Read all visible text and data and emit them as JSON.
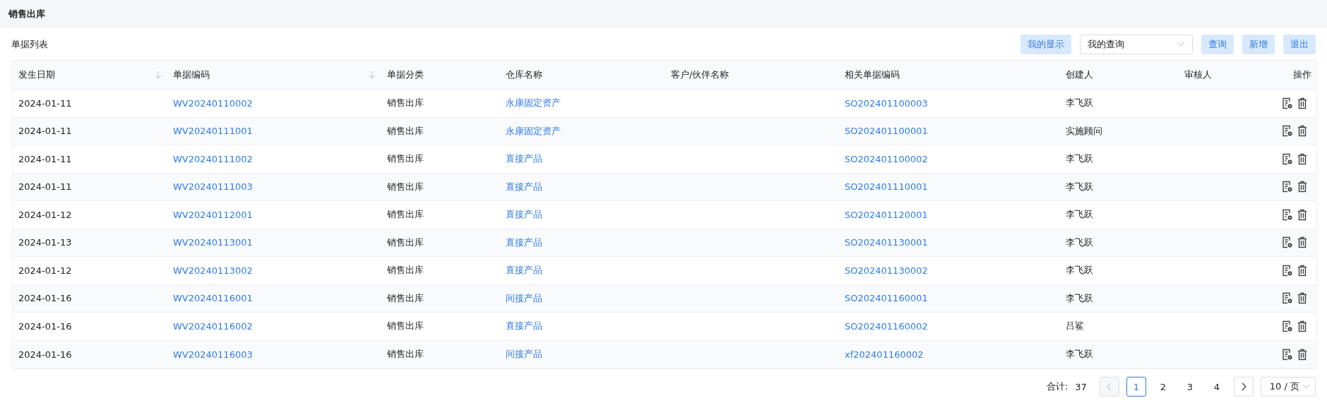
{
  "page_title": "销售出库",
  "list_title": "单据列表",
  "toolbar": [
    {
      "kind": "button",
      "label": "我的显示"
    },
    {
      "kind": "select",
      "value": "我的查询"
    },
    {
      "kind": "button",
      "label": "查询"
    },
    {
      "kind": "button",
      "label": "新增"
    },
    {
      "kind": "button",
      "label": "退出"
    }
  ],
  "table": {
    "columns": [
      {
        "label": "发生日期",
        "sortable": true,
        "kind": "text"
      },
      {
        "label": "单据编码",
        "sortable": true,
        "kind": "link"
      },
      {
        "label": "单据分类",
        "sortable": false,
        "kind": "text"
      },
      {
        "label": "仓库名称",
        "sortable": false,
        "kind": "link"
      },
      {
        "label": "客户/伙伴名称",
        "sortable": false,
        "kind": "text"
      },
      {
        "label": "相关单据编码",
        "sortable": false,
        "kind": "link"
      },
      {
        "label": "创建人",
        "sortable": false,
        "kind": "text"
      },
      {
        "label": "审核人",
        "sortable": false,
        "kind": "text"
      },
      {
        "label": "操作",
        "sortable": false,
        "kind": "actions"
      }
    ],
    "rows": [
      [
        "2024-01-11",
        "WV20240110002",
        "销售出库",
        "永康固定资产",
        "",
        "SO202401100003",
        "李飞跃",
        ""
      ],
      [
        "2024-01-11",
        "WV20240111001",
        "销售出库",
        "永康固定资产",
        "",
        "SO202401100001",
        "实施顾问",
        ""
      ],
      [
        "2024-01-11",
        "WV20240111002",
        "销售出库",
        "直接产品",
        "",
        "SO202401100002",
        "李飞跃",
        ""
      ],
      [
        "2024-01-11",
        "WV20240111003",
        "销售出库",
        "直接产品",
        "",
        "SO202401110001",
        "李飞跃",
        ""
      ],
      [
        "2024-01-12",
        "WV20240112001",
        "销售出库",
        "直接产品",
        "",
        "SO202401120001",
        "李飞跃",
        ""
      ],
      [
        "2024-01-13",
        "WV20240113001",
        "销售出库",
        "直接产品",
        "",
        "SO202401130001",
        "李飞跃",
        ""
      ],
      [
        "2024-01-12",
        "WV20240113002",
        "销售出库",
        "直接产品",
        "",
        "SO202401130002",
        "李飞跃",
        ""
      ],
      [
        "2024-01-16",
        "WV20240116001",
        "销售出库",
        "间接产品",
        "",
        "SO202401160001",
        "李飞跃",
        ""
      ],
      [
        "2024-01-16",
        "WV20240116002",
        "销售出库",
        "直接产品",
        "",
        "SO202401160002",
        "吕鲨",
        ""
      ],
      [
        "2024-01-16",
        "WV20240116003",
        "销售出库",
        "间接产品",
        "",
        "xf202401160002",
        "李飞跃",
        ""
      ]
    ]
  },
  "pagination": {
    "total_label": "合计:",
    "total": "37",
    "prev_disabled": true,
    "pages": [
      {
        "label": "1",
        "selected": true
      },
      {
        "label": "2",
        "selected": false
      },
      {
        "label": "3",
        "selected": false
      },
      {
        "label": "4",
        "selected": false
      }
    ],
    "page_size": "10 / 页"
  }
}
